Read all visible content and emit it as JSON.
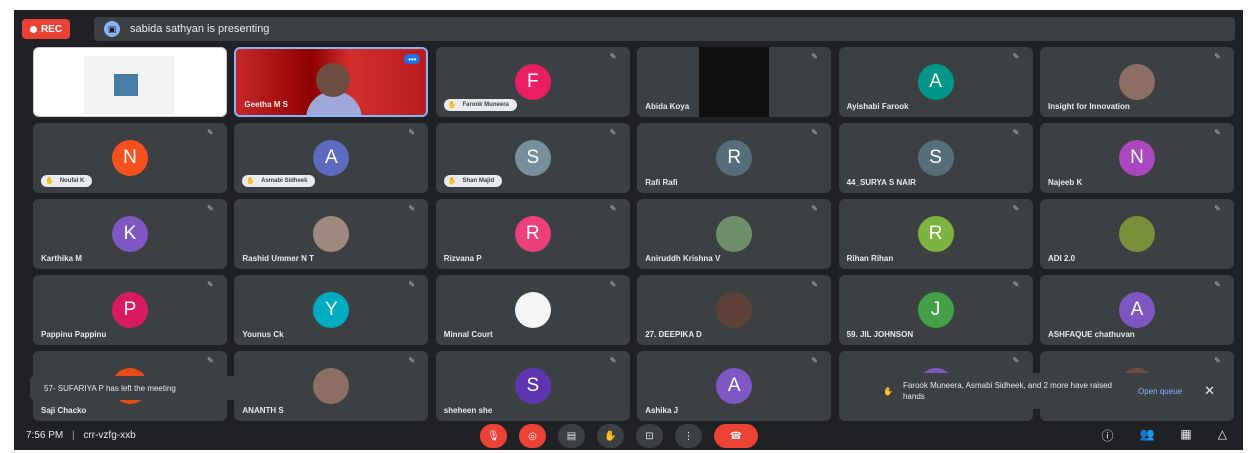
{
  "topbar": {
    "rec_label": "REC",
    "presenting_text": "sabida sathyan is presenting"
  },
  "tiles": [
    {
      "name": "",
      "kind": "screen"
    },
    {
      "name": "Geetha M S",
      "kind": "video"
    },
    {
      "name": "Farook Muneera",
      "kind": "letter",
      "letter": "F",
      "color": "#e91e63",
      "hand": true
    },
    {
      "name": "Abida Koya",
      "kind": "dark"
    },
    {
      "name": "Ayishabi Farook",
      "kind": "letter",
      "letter": "A",
      "color": "#009688"
    },
    {
      "name": "Insight for Innovation",
      "kind": "photo",
      "color": "#8d6e63"
    },
    {
      "name": "Noufal K",
      "kind": "letter",
      "letter": "N",
      "color": "#f4511e",
      "hand": true
    },
    {
      "name": "Asmabi Sidheek",
      "kind": "letter",
      "letter": "A",
      "color": "#5c6bc0",
      "hand": true
    },
    {
      "name": "Shan Majid",
      "kind": "letter",
      "letter": "S",
      "color": "#78909c",
      "hand": true
    },
    {
      "name": "Rafi Rafi",
      "kind": "letter",
      "letter": "R",
      "color": "#546e7a"
    },
    {
      "name": "44_SURYA S NAIR",
      "kind": "letter",
      "letter": "S",
      "color": "#546e7a"
    },
    {
      "name": "Najeeb K",
      "kind": "letter",
      "letter": "N",
      "color": "#ab47bc"
    },
    {
      "name": "Karthika M",
      "kind": "letter",
      "letter": "K",
      "color": "#7e57c2"
    },
    {
      "name": "Rashid Ummer N T",
      "kind": "photo",
      "color": "#a1887f"
    },
    {
      "name": "Rizvana P",
      "kind": "letter",
      "letter": "R",
      "color": "#ec407a"
    },
    {
      "name": "Aniruddh Krishna V",
      "kind": "photo",
      "color": "#6d8f6a"
    },
    {
      "name": "Rihan Rihan",
      "kind": "letter",
      "letter": "R",
      "color": "#7cb342"
    },
    {
      "name": "ADI 2.0",
      "kind": "photo",
      "color": "#7a8f3a"
    },
    {
      "name": "Pappinu Pappinu",
      "kind": "letter",
      "letter": "P",
      "color": "#d81b60"
    },
    {
      "name": "Younus Ck",
      "kind": "letter",
      "letter": "Y",
      "color": "#00acc1"
    },
    {
      "name": "Minnal Court",
      "kind": "photo",
      "color": "#f5f5f5"
    },
    {
      "name": "27. DEEPIKA D",
      "kind": "photo",
      "color": "#5d4037"
    },
    {
      "name": "59. JIL JOHNSON",
      "kind": "letter",
      "letter": "J",
      "color": "#43a047"
    },
    {
      "name": "ASHFAQUE chathuvan",
      "kind": "letter",
      "letter": "A",
      "color": "#7e57c2"
    },
    {
      "name": "Saji Chacko",
      "kind": "photo",
      "color": "#e64a19"
    },
    {
      "name": "ANANTH S",
      "kind": "photo",
      "color": "#8d6e63"
    },
    {
      "name": "sheheen she",
      "kind": "letter",
      "letter": "S",
      "color": "#5e35b1"
    },
    {
      "name": "Ashika J",
      "kind": "letter",
      "letter": "A",
      "color": "#7e57c2"
    },
    {
      "name": "",
      "kind": "group",
      "color": "#7e57c2"
    },
    {
      "name": "",
      "kind": "photo",
      "color": "#6d4c41"
    }
  ],
  "toast": {
    "text": "57- SUFARIYA P has left the meeting"
  },
  "raised_hands": {
    "text": "Farook Muneera, Asmabi Sidheek, and 2 more have raised hands",
    "action": "Open queue"
  },
  "bottombar": {
    "time": "7:56 PM",
    "meeting_code": "crr-vzfg-xxb"
  },
  "icons": {
    "hand": "raised-hand-icon",
    "mic_off": "mic-off-icon"
  }
}
